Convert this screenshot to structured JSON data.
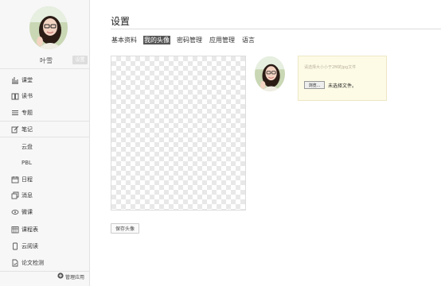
{
  "user": {
    "name": "叶雪",
    "settings_tag": "设置"
  },
  "sidebar": {
    "items": [
      {
        "label": "课堂",
        "icon": "bar-chart-icon"
      },
      {
        "label": "读书",
        "icon": "book-icon"
      },
      {
        "label": "专题",
        "icon": "list-icon"
      },
      {
        "label": "笔记",
        "icon": "note-edit-icon"
      },
      {
        "label": "云盘",
        "icon": ""
      },
      {
        "label": "PBL",
        "icon": ""
      },
      {
        "label": "日程",
        "icon": "calendar-icon"
      },
      {
        "label": "消息",
        "icon": "message-icon"
      },
      {
        "label": "微课",
        "icon": "eye-icon"
      },
      {
        "label": "课程表",
        "icon": "timetable-icon"
      },
      {
        "label": "云阅读",
        "icon": "phone-icon"
      },
      {
        "label": "论文检测",
        "icon": "document-check-icon"
      }
    ],
    "manage_apps": "管理应用"
  },
  "main": {
    "title": "设置",
    "tabs": [
      {
        "label": "基本资料"
      },
      {
        "label": "我的头像"
      },
      {
        "label": "密码管理"
      },
      {
        "label": "应用管理"
      },
      {
        "label": "语言"
      }
    ],
    "active_tab": "我的头像",
    "upload": {
      "hint": "请选择大小小于2M的jpg文件",
      "browse_label": "浏览...",
      "no_file_label": "未选择文件。"
    },
    "save_button": "保存头像"
  }
}
